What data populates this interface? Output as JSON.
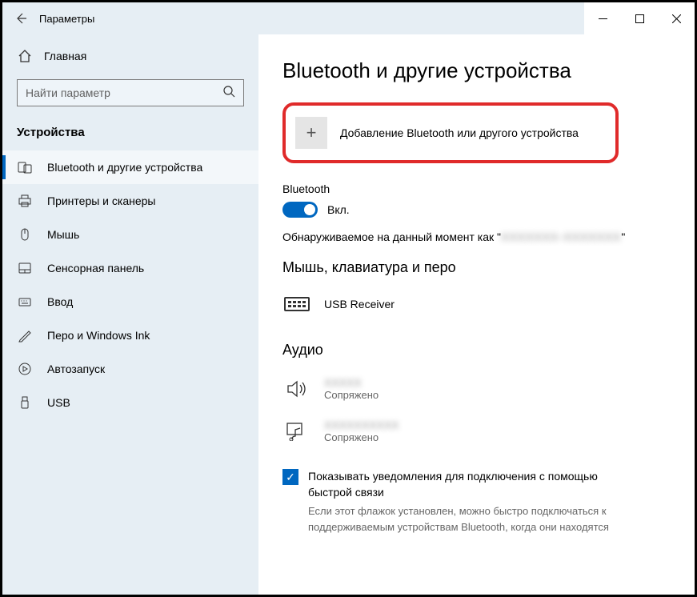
{
  "window": {
    "title": "Параметры"
  },
  "sidebar": {
    "home_label": "Главная",
    "search_placeholder": "Найти параметр",
    "category": "Устройства",
    "items": [
      {
        "label": "Bluetooth и другие устройства",
        "icon": "bluetooth-devices",
        "selected": true
      },
      {
        "label": "Принтеры и сканеры",
        "icon": "printer",
        "selected": false
      },
      {
        "label": "Мышь",
        "icon": "mouse",
        "selected": false
      },
      {
        "label": "Сенсорная панель",
        "icon": "touchpad",
        "selected": false
      },
      {
        "label": "Ввод",
        "icon": "keyboard",
        "selected": false
      },
      {
        "label": "Перо и Windows Ink",
        "icon": "pen",
        "selected": false
      },
      {
        "label": "Автозапуск",
        "icon": "autoplay",
        "selected": false
      },
      {
        "label": "USB",
        "icon": "usb",
        "selected": false
      }
    ]
  },
  "main": {
    "heading": "Bluetooth и другие устройства",
    "add_device_label": "Добавление Bluetooth или другого устройства",
    "bluetooth": {
      "section_label": "Bluetooth",
      "toggle_on": true,
      "toggle_label": "Вкл.",
      "discoverable_prefix": "Обнаруживаемое на данный момент как \"",
      "discoverable_name": "XXXXXXX-XXXXXXX",
      "discoverable_suffix": "\""
    },
    "mouse_section": {
      "heading": "Мышь, клавиатура и перо",
      "devices": [
        {
          "name": "USB Receiver",
          "status": "",
          "icon": "keyboard"
        }
      ]
    },
    "audio_section": {
      "heading": "Аудио",
      "devices": [
        {
          "name": "XXXXX",
          "status": "Сопряжено",
          "icon": "speaker"
        },
        {
          "name": "XXXXXXXXXX",
          "status": "Сопряжено",
          "icon": "media"
        }
      ]
    },
    "quick_pair": {
      "checked": true,
      "label": "Показывать уведомления для подключения с помощью быстрой связи",
      "description": "Если этот флажок установлен, можно быстро подключаться к поддерживаемым устройствам Bluetooth, когда они находятся"
    }
  }
}
